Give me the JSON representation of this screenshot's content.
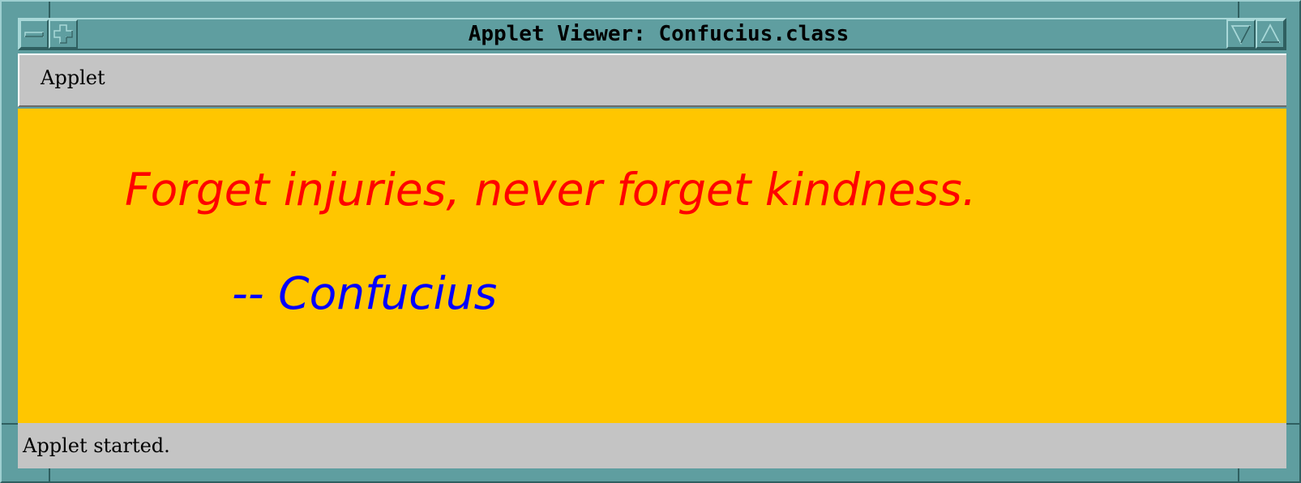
{
  "window": {
    "title": "Applet Viewer: Confucius.class"
  },
  "titlebar_icons": {
    "left": [
      "minimize-bar-icon",
      "plus-icon"
    ],
    "right": [
      "down-triangle-icon",
      "up-triangle-icon"
    ]
  },
  "menubar": {
    "items": [
      {
        "label": "Applet"
      }
    ]
  },
  "applet": {
    "quote": "Forget injuries, never forget kindness.",
    "author": "-- Confucius",
    "background_color": "#ffc600",
    "quote_color": "#ff0000",
    "author_color": "#0000ff"
  },
  "status": {
    "text": "Applet started."
  },
  "colors": {
    "frame": "#5f9ea0",
    "chrome": "#c4c4c4"
  }
}
